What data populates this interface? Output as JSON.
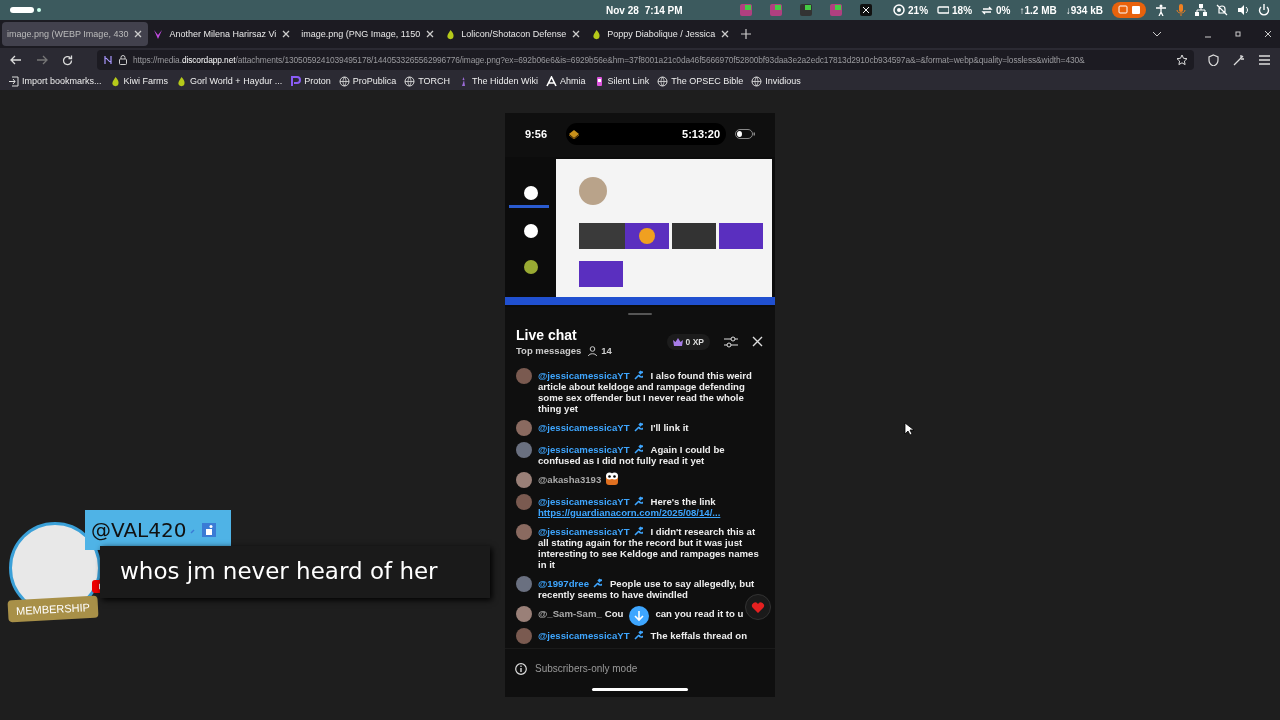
{
  "system_bar": {
    "date": "Nov 28",
    "time": "7:14 PM",
    "stats": [
      {
        "kind": "cpu",
        "text": "21%"
      },
      {
        "kind": "memory",
        "text": "18%"
      },
      {
        "kind": "swap",
        "text": "0%"
      },
      {
        "kind": "upload",
        "text": "↑1.2 MB"
      },
      {
        "kind": "download",
        "text": "↓934 kB"
      }
    ]
  },
  "tabs": [
    {
      "title": "image.png (WEBP Image, 430",
      "selected": true
    },
    {
      "title": "Another Milena Harirsaz Vi",
      "selected": false
    },
    {
      "title": "image.png (PNG Image, 1150",
      "selected": false
    },
    {
      "title": "Lolicon/Shotacon Defense",
      "selected": false
    },
    {
      "title": "Poppy Diabolique / Jessica",
      "selected": false
    }
  ],
  "address_bar": {
    "prefix": "https://media.",
    "domain": "discordapp.net",
    "rest": "/attachments/1305059241039495178/1440533265562996776/image.png?ex=692b06e6&is=6929b56e&hm=37f8001a21c0da46f5666970f52800bf93daa3e2a2edc17813d2910cb934597a&=&format=webp&quality=lossless&width=430&"
  },
  "bookmarks": [
    "Import bookmarks...",
    "Kiwi Farms",
    "Gorl World + Haydur ...",
    "Proton",
    "ProPublica",
    "TORCH",
    "The Hidden Wiki",
    "Ahmia",
    "Silent Link",
    "The OPSEC Bible",
    "Invidious"
  ],
  "phone": {
    "clock": "9:56",
    "timer": "5:13:20",
    "chat": {
      "title": "Live chat",
      "filter": "Top messages",
      "viewers": "14",
      "xp": "0 XP",
      "messages": [
        {
          "author": "@jessicamessicaYT",
          "member": true,
          "kind": "text",
          "text": "I also found this weird article about keldoge and rampage defending some sex offender but I never read the whole thing yet"
        },
        {
          "author": "@jessicamessicaYT",
          "member": true,
          "kind": "text",
          "text": "I'll link it"
        },
        {
          "author": "@jessicamessicaYT",
          "member": true,
          "kind": "text",
          "text": "Again I could be confused as I did not fully read it yet"
        },
        {
          "author": "@akasha3193",
          "member": false,
          "kind": "sticker"
        },
        {
          "author": "@jessicamessicaYT",
          "member": true,
          "kind": "text",
          "text": "Here's the link",
          "link": "https://guardianacorn.com/2025/08/14/..."
        },
        {
          "author": "@jessicamessicaYT",
          "member": true,
          "kind": "text",
          "text": "I didn't research this at all stating again for the record but it was just interesting to see Keldoge and rampages names in it"
        },
        {
          "author": "@1997dree",
          "member": true,
          "kind": "text",
          "text": "People use to say allegedly, but recently seems to have dwindled"
        },
        {
          "author": "@_Sam-Sam_",
          "member": false,
          "kind": "text",
          "text": "Cou",
          "text_after": "can you read it to u"
        },
        {
          "author": "@jessicamessicaYT",
          "member": true,
          "kind": "text",
          "text": "The keffals thread on"
        }
      ],
      "footer": "Subscribers-only mode"
    }
  },
  "overlay": {
    "author": "@VAL420",
    "message": "whos jm never heard of her",
    "badge": "MEMBERSHIP"
  }
}
